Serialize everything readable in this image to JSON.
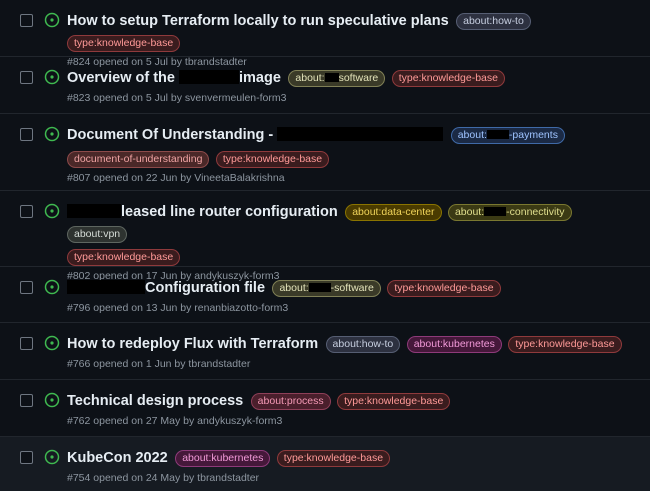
{
  "issues": [
    {
      "title": "How to setup Terraform locally to run speculative plans",
      "meta": "#824 opened on 5 Jul by tbrandstadter",
      "labels": [
        "about:how-to",
        "type:knowledge-base"
      ]
    },
    {
      "title_parts": [
        "Overview of the",
        "image"
      ],
      "meta": "#823 opened on 5 Jul by svenvermeulen-form3",
      "labels": [
        [
          "about:",
          "software"
        ],
        "type:knowledge-base"
      ]
    },
    {
      "title": "Document Of Understanding -",
      "meta": "#807 opened on 22 Jun by VineetaBalakrishna",
      "labels": [
        [
          "about:",
          "-payments"
        ],
        "document-of-understanding",
        "type:knowledge-base"
      ]
    },
    {
      "title": "leased line router configuration",
      "meta": "#802 opened on 17 Jun by andykuszyk-form3",
      "labels": [
        "about:data-center",
        [
          "about:",
          "-connectivity"
        ],
        "about:vpn",
        "type:knowledge-base"
      ]
    },
    {
      "title": "Configuration file",
      "meta": "#796 opened on 13 Jun by renanbiazotto-form3",
      "labels": [
        [
          "about:",
          "-software"
        ],
        "type:knowledge-base"
      ]
    },
    {
      "title": "How to redeploy Flux with Terraform",
      "meta": "#766 opened on 1 Jun by tbrandstadter",
      "labels": [
        "about:how-to",
        "about:kubernetes",
        "type:knowledge-base"
      ]
    },
    {
      "title": "Technical design process",
      "meta": "#762 opened on 27 May by andykuszyk-form3",
      "labels": [
        "about:process",
        "type:knowledge-base"
      ]
    },
    {
      "title": "KubeCon 2022",
      "meta": "#754 opened on 24 May by tbrandstadter",
      "labels": [
        "about:kubernetes",
        "type:knowledge-base"
      ]
    }
  ],
  "colors": {
    "background": "#0d1117",
    "open_icon": "#3fb950",
    "meta_text": "#8d96a0"
  },
  "icons": {
    "status": "issue-opened-icon",
    "select": "checkbox"
  }
}
